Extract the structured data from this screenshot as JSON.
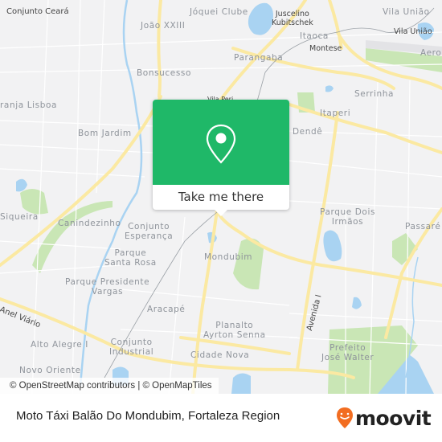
{
  "map": {
    "neighborhood_labels": [
      {
        "id": "conjunto-ceara",
        "text": "Conjunto Ceará",
        "style": "dark"
      },
      {
        "id": "joquei-clube",
        "text": "Jóquei Clube"
      },
      {
        "id": "joao-xxiii",
        "text": "João XXIII"
      },
      {
        "id": "juscelino-kubitschek",
        "text": "Juscelino\nKubitschek",
        "style": "dark"
      },
      {
        "id": "itaoca",
        "text": "Itaoca"
      },
      {
        "id": "montese",
        "text": "Montese",
        "style": "dark"
      },
      {
        "id": "vila-uniao",
        "text": "Vila União"
      },
      {
        "id": "vila-uniao-station",
        "text": "Vila União",
        "style": "dark"
      },
      {
        "id": "parangaba",
        "text": "Parangaba"
      },
      {
        "id": "bonsucesso",
        "text": "Bonsucesso"
      },
      {
        "id": "granja-lisboa",
        "text": "ranja Lisboa"
      },
      {
        "id": "serrinha",
        "text": "Serrinha"
      },
      {
        "id": "itaperi",
        "text": "Itaperi"
      },
      {
        "id": "bom-jardim",
        "text": "Bom Jardim"
      },
      {
        "id": "dende",
        "text": "Dendê"
      },
      {
        "id": "siqueira",
        "text": "Siqueira"
      },
      {
        "id": "canindezinho",
        "text": "Canindezinho"
      },
      {
        "id": "conjunto-esperanca",
        "text": "Conjunto\nEsperança"
      },
      {
        "id": "parque-dois-irmaos",
        "text": "Parque Dois\nIrmãos"
      },
      {
        "id": "passare",
        "text": "Passaré"
      },
      {
        "id": "parque-santa-rosa",
        "text": "Parque\nSanta Rosa"
      },
      {
        "id": "mondubim",
        "text": "Mondubim"
      },
      {
        "id": "parque-presidente-vargas",
        "text": "Parque Presidente\nVargas"
      },
      {
        "id": "aracape",
        "text": "Aracapé"
      },
      {
        "id": "avenida-i",
        "text": "Avenida I",
        "style": "dark"
      },
      {
        "id": "anel-viario",
        "text": "Anel Viário",
        "style": "dark"
      },
      {
        "id": "planalto-ayrton-senna",
        "text": "Planalto\nAyrton Senna"
      },
      {
        "id": "alto-alegre-i",
        "text": "Alto Alegre I"
      },
      {
        "id": "conjunto-industrial",
        "text": "Conjunto\nIndustrial"
      },
      {
        "id": "cidade-nova",
        "text": "Cidade Nova"
      },
      {
        "id": "prefeito-jose-walter",
        "text": "Prefeito\nJosé Walter"
      },
      {
        "id": "novo-oriente",
        "text": "Novo Oriente"
      },
      {
        "id": "aerop",
        "text": "Aerop"
      },
      {
        "id": "vila-peri",
        "text": "Vila Peri",
        "style": "dark"
      }
    ],
    "colors": {
      "background": "#f2f2f3",
      "road_major": "#fbe9a2",
      "road_minor": "#ffffff",
      "water": "#a9d3f2",
      "park": "#c9e6b5",
      "popup_green": "#1fb868"
    }
  },
  "popup": {
    "icon": "map-pin-icon",
    "cta_label": "Take me there"
  },
  "attribution": "© OpenStreetMap contributors | © OpenMapTiles",
  "footer": {
    "place_title": "Moto Táxi Balão Do Mondubim, Fortaleza Region",
    "brand": "moovit",
    "brand_color": "#f26d21"
  }
}
